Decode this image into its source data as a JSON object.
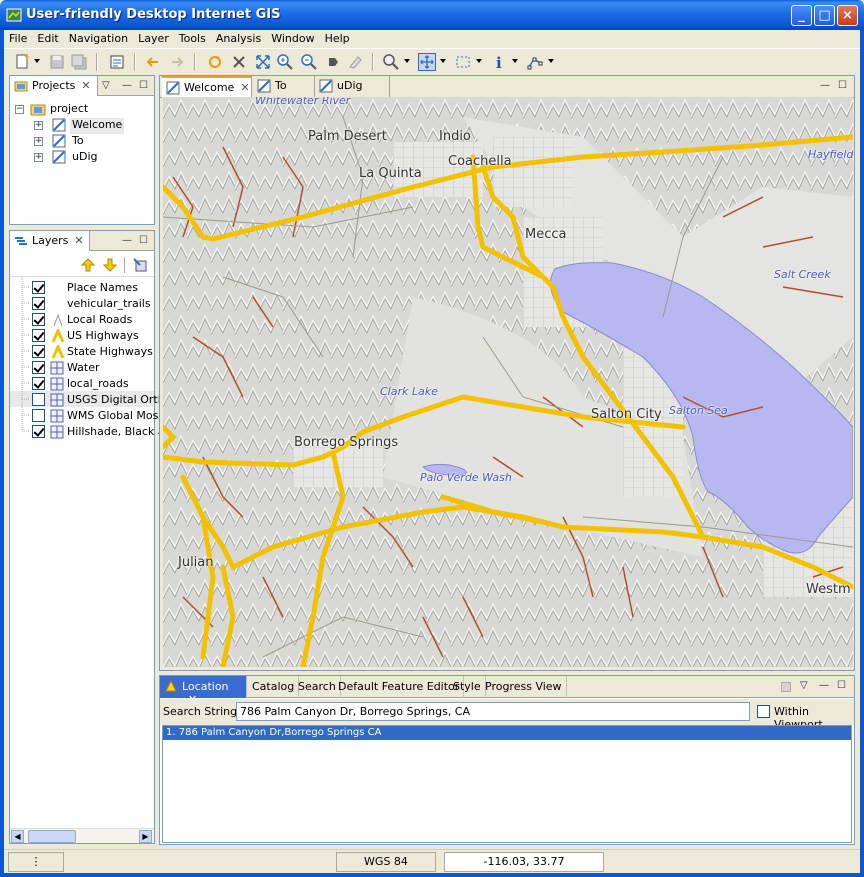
{
  "window": {
    "title": "User-friendly Desktop Internet GIS"
  },
  "menu": [
    "File",
    "Edit",
    "Navigation",
    "Layer",
    "Tools",
    "Analysis",
    "Window",
    "Help"
  ],
  "projects_view": {
    "tab_label": "Projects",
    "root": "project",
    "maps": [
      "Welcome",
      "To",
      "uDig"
    ]
  },
  "layers_view": {
    "tab_label": "Layers",
    "layers": [
      {
        "name": "Place Names",
        "checked": true,
        "icon": "none"
      },
      {
        "name": "vehicular_trails",
        "checked": true,
        "icon": "none"
      },
      {
        "name": "Local Roads",
        "checked": true,
        "icon": "road-thin-icon"
      },
      {
        "name": "US Highways",
        "checked": true,
        "icon": "road-yellow-icon"
      },
      {
        "name": "State Highways",
        "checked": true,
        "icon": "road-yellow-icon"
      },
      {
        "name": "Water",
        "checked": true,
        "icon": "grid-icon"
      },
      {
        "name": "local_roads",
        "checked": true,
        "icon": "grid-icon"
      },
      {
        "name": "USGS Digital Ortho",
        "checked": false,
        "icon": "grid-icon"
      },
      {
        "name": "WMS Global Mosai",
        "checked": false,
        "icon": "grid-icon"
      },
      {
        "name": "Hillshade, Black ar",
        "checked": true,
        "icon": "grid-icon"
      }
    ]
  },
  "editor_tabs": [
    {
      "label": "Welcome",
      "active": true,
      "closable": true
    },
    {
      "label": "To",
      "active": false,
      "closable": false
    },
    {
      "label": "uDig",
      "active": false,
      "closable": false
    }
  ],
  "map": {
    "places": [
      "Palm Desert",
      "Indio",
      "Coachella",
      "La Quinta",
      "Mecca",
      "Salton City",
      "Borrego Springs",
      "Julian",
      "Westm",
      "Hayfield"
    ],
    "water_labels": [
      "Whitewater River",
      "Salt Creek",
      "Clark Lake",
      "Salton Sea",
      "Palo Verde Wash"
    ],
    "colors": {
      "water": "#b8b8f0",
      "highway": "#f2c200",
      "trail": "#b0502a",
      "background": "#dcdcd8"
    }
  },
  "bottom_tabs": [
    "Location",
    "Catalog",
    "Search",
    "Default Feature Editor",
    "Style",
    "Progress View"
  ],
  "location": {
    "search_label": "Search String:",
    "search_value": "786 Palm Canyon Dr, Borrego Springs, CA",
    "within_viewport_label": "Within Viewport",
    "within_viewport_checked": false,
    "results": [
      "1. 786 Palm Canyon Dr,Borrego Springs CA"
    ]
  },
  "status": {
    "crs": "WGS 84",
    "coords": "-116.03, 33.77"
  }
}
